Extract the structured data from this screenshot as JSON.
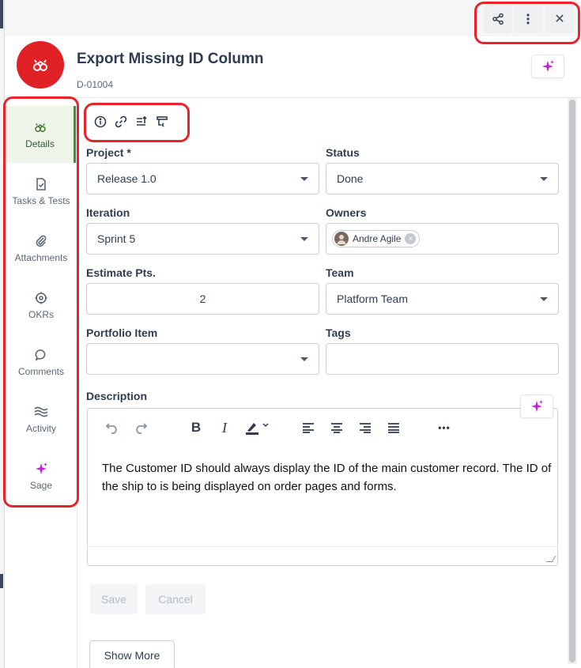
{
  "header": {
    "title": "Export Missing ID Column",
    "id": "D-01004",
    "share_icon": "share-icon",
    "more_icon": "more-vertical-icon",
    "close_glyph": "✕"
  },
  "sidebar": {
    "items": [
      {
        "label": "Details",
        "icon": "details-icon"
      },
      {
        "label": "Tasks & Tests",
        "icon": "tasks-icon"
      },
      {
        "label": "Attachments",
        "icon": "paperclip-icon"
      },
      {
        "label": "OKRs",
        "icon": "target-icon"
      },
      {
        "label": "Comments",
        "icon": "comment-icon"
      },
      {
        "label": "Activity",
        "icon": "activity-icon"
      },
      {
        "label": "Sage",
        "icon": "sparkle-icon"
      }
    ]
  },
  "fields": {
    "project": {
      "label": "Project *",
      "value": "Release 1.0"
    },
    "status": {
      "label": "Status",
      "value": "Done"
    },
    "iteration": {
      "label": "Iteration",
      "value": "Sprint 5"
    },
    "owners": {
      "label": "Owners",
      "value": "Andre Agile"
    },
    "estimate": {
      "label": "Estimate Pts.",
      "value": "2"
    },
    "team": {
      "label": "Team",
      "value": "Platform Team"
    },
    "portfolio": {
      "label": "Portfolio Item",
      "value": ""
    },
    "tags": {
      "label": "Tags",
      "value": ""
    }
  },
  "description": {
    "label": "Description",
    "text": "The Customer ID should always display the ID of the main customer record. The ID of the ship to is being displayed on order pages and forms.",
    "toolbar": {
      "bold": "B",
      "italic": "I",
      "more": "•••"
    }
  },
  "actions": {
    "save": "Save",
    "cancel": "Cancel",
    "show_more": "Show More"
  },
  "colors": {
    "accent_red": "#e02227",
    "highlight": "#e8232b",
    "sage_magenta": "#c026d3",
    "active_tab": "#eef6ea"
  }
}
